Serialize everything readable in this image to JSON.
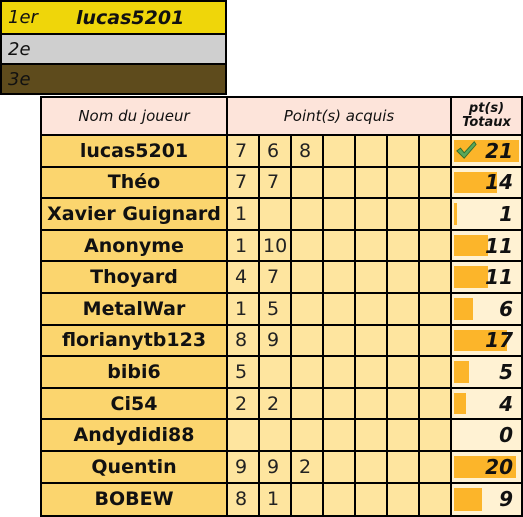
{
  "podium": [
    {
      "rank": "1er",
      "name": "lucas5201",
      "color": "#efd60a"
    },
    {
      "rank": "2e",
      "name": "",
      "color": "#cfcfcf"
    },
    {
      "rank": "3e",
      "name": "",
      "color": "#5e4b1c"
    }
  ],
  "table": {
    "headers": {
      "name": "Nom du joueur",
      "points": "Point(s) acquis",
      "total_line1": "pt(s)",
      "total_line2": "Totaux"
    },
    "max_total": 21,
    "rows": [
      {
        "name": "lucas5201",
        "points": [
          "7",
          "6",
          "8",
          "",
          "",
          "",
          ""
        ],
        "total": 21,
        "total_label": "21",
        "winner": true
      },
      {
        "name": "Théo",
        "points": [
          "7",
          "7",
          "",
          "",
          "",
          "",
          ""
        ],
        "total": 14,
        "total_label": "14",
        "winner": false
      },
      {
        "name": "Xavier Guignard",
        "points": [
          "1",
          "",
          "",
          "",
          "",
          "",
          ""
        ],
        "total": 1,
        "total_label": "1",
        "winner": false
      },
      {
        "name": "Anonyme",
        "points": [
          "1",
          "10",
          "",
          "",
          "",
          "",
          ""
        ],
        "total": 11,
        "total_label": "11",
        "winner": false
      },
      {
        "name": "Thoyard",
        "points": [
          "4",
          "7",
          "",
          "",
          "",
          "",
          ""
        ],
        "total": 11,
        "total_label": "11",
        "winner": false
      },
      {
        "name": "MetalWar",
        "points": [
          "1",
          "5",
          "",
          "",
          "",
          "",
          ""
        ],
        "total": 6,
        "total_label": "6",
        "winner": false
      },
      {
        "name": "florianytb123",
        "points": [
          "8",
          "9",
          "",
          "",
          "",
          "",
          ""
        ],
        "total": 17,
        "total_label": "17",
        "winner": false
      },
      {
        "name": "bibi6",
        "points": [
          "5",
          "",
          "",
          "",
          "",
          "",
          ""
        ],
        "total": 5,
        "total_label": "5",
        "winner": false
      },
      {
        "name": "Ci54",
        "points": [
          "2",
          "2",
          "",
          "",
          "",
          "",
          ""
        ],
        "total": 4,
        "total_label": "4",
        "winner": false
      },
      {
        "name": "Andydidi88",
        "points": [
          "",
          "",
          "",
          "",
          "",
          "",
          ""
        ],
        "total": 0,
        "total_label": "0",
        "winner": false
      },
      {
        "name": "Quentin",
        "points": [
          "9",
          "9",
          "2",
          "",
          "",
          "",
          ""
        ],
        "total": 20,
        "total_label": "20",
        "winner": false
      },
      {
        "name": "BOBEW",
        "points": [
          "8",
          "1",
          "",
          "",
          "",
          "",
          ""
        ],
        "total": 9,
        "total_label": "9",
        "winner": false
      }
    ]
  },
  "icons": {
    "winner": "check-icon"
  },
  "colors": {
    "bar": "#fcb52a",
    "name_bg": "#fbd56e",
    "points_bg": "#fee59f",
    "total_bg": "#fff2d3",
    "header_bg": "#fde4da",
    "check": "#5aa85a"
  }
}
